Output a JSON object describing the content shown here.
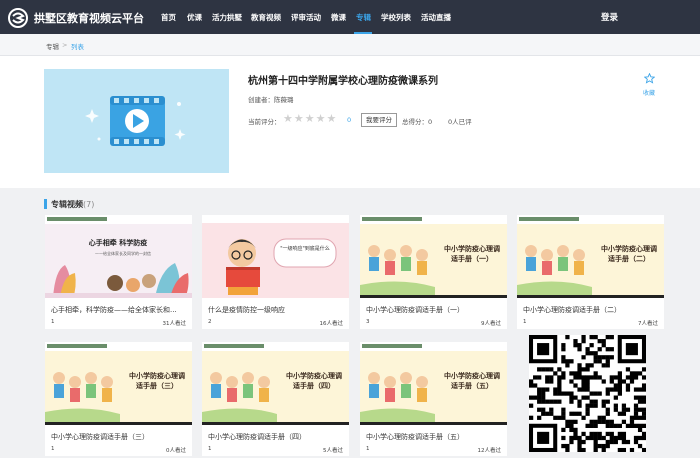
{
  "brand": {
    "name": "拱墅区教育视频云平台"
  },
  "nav": {
    "items": [
      {
        "label": "首页"
      },
      {
        "label": "优课"
      },
      {
        "label": "活力拱墅"
      },
      {
        "label": "教育视频"
      },
      {
        "label": "评审活动"
      },
      {
        "label": "微课"
      },
      {
        "label": "专辑",
        "active": true
      },
      {
        "label": "学校列表"
      },
      {
        "label": "活动直播"
      }
    ],
    "login": "登录",
    "accent": "#3ba4e8",
    "bg": "#2e3442"
  },
  "breadcrumb": {
    "root": "专辑",
    "sep": ">",
    "current": "列表"
  },
  "album": {
    "title": "杭州第十四中学附属学校心理防疫微课系列",
    "creator": "创建者：陈薇璐",
    "rating_label": "当前评分：",
    "rating_value": "0",
    "rating_stars": 0,
    "rate_button": "我要评分",
    "total_label": "总得分：0",
    "rated_count": "0人已评",
    "favorite": "收藏"
  },
  "section": {
    "title": "专辑视频",
    "count": "(7)"
  },
  "videos": [
    {
      "title": "心手相牵，科学防疫——给全体家长和...",
      "num": "1",
      "views": "31人看过",
      "thumb": "hands"
    },
    {
      "title": "什么是疫情防控一级响应",
      "num": "2",
      "views": "16人看过",
      "thumb": "reader"
    },
    {
      "title": "中小学心理防疫调适手册（一）",
      "num": "3",
      "views": "9人看过",
      "thumb": "kids"
    },
    {
      "title": "中小学心理防疫调适手册（二）",
      "num": "1",
      "views": "7人看过",
      "thumb": "kids"
    },
    {
      "title": "中小学心理防疫调适手册（三）",
      "num": "1",
      "views": "0人看过",
      "thumb": "kids"
    },
    {
      "title": "中小学心理防疫调适手册（四）",
      "num": "1",
      "views": "5人看过",
      "thumb": "kids"
    },
    {
      "title": "中小学心理防疫调适手册（五）",
      "num": "1",
      "views": "12人看过",
      "thumb": "kids"
    }
  ],
  "thumb_text": {
    "hands_title": "心手相牵  科学防疫",
    "hands_sub": "——给全体家长及同学的一封信",
    "reader_bubble": "\"一级响应\"到底是什么",
    "kids_title_1": "中小学防疫心理调",
    "kids_title_2": "适手册",
    "kids_parts": [
      "（一）",
      "（二）",
      "（三）",
      "（四）",
      "（五）"
    ]
  }
}
